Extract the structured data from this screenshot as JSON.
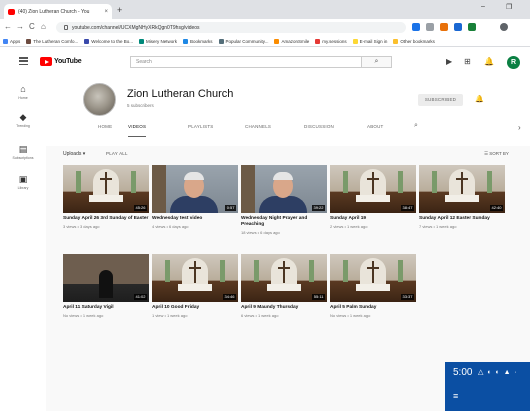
{
  "browser": {
    "tab_title": "(40) Zion Lutheran Church - You",
    "tab_close": "×",
    "new_tab": "+",
    "window_controls": [
      "–",
      "❐"
    ],
    "nav": [
      "←",
      "→",
      "C",
      "⌂"
    ],
    "url": "youtube.com/channel/UCXMgNHyXRkQgn0T9hsg/videos",
    "bookmarks": [
      "Apps",
      "The Lutheran Comfo...",
      "Welcome to the Bo...",
      "Misery Network",
      "Bookmarks",
      "Popular Community...",
      "AmazonSmile",
      "my.sessions",
      "E-mail Sign in",
      "Other bookmarks"
    ]
  },
  "masthead": {
    "logo_text": "YouTube",
    "search_placeholder": "Search",
    "search_icon": "⌕",
    "icons": [
      "▶",
      "⊞",
      "🔔"
    ],
    "avatar_letter": "R"
  },
  "guide": [
    {
      "icon": "⌂",
      "label": "Home"
    },
    {
      "icon": "◆",
      "label": "Trending"
    },
    {
      "icon": "▤",
      "label": "Subscriptions"
    },
    {
      "icon": "▣",
      "label": "Library"
    }
  ],
  "channel": {
    "name": "Zion Lutheran Church",
    "subscribers": "5 subscribers",
    "subscribe_label": "SUBSCRIBED",
    "bell": "🔔",
    "tabs": [
      "HOME",
      "VIDEOS",
      "PLAYLISTS",
      "CHANNELS",
      "DISCUSSION",
      "ABOUT"
    ],
    "active_tab": "VIDEOS",
    "tab_search": "⌕",
    "tab_arrow": "›"
  },
  "uploads": {
    "label": "Uploads ▾",
    "play_all": "PLAY ALL",
    "sort": "☰  SORT BY"
  },
  "videos": [
    {
      "title": "Sunday April 26 3rd Sunday of Easter",
      "meta": "3 views • 3 days ago",
      "duration": "45:26",
      "thumb": "church"
    },
    {
      "title": "Wednesday test video",
      "meta": "4 views • 6 days ago",
      "duration": "0:57",
      "thumb": "man"
    },
    {
      "title": "Wednesday Night Prayer and Preaching",
      "meta": "18 views • 6 days ago",
      "duration": "39:22",
      "thumb": "man"
    },
    {
      "title": "Sunday April 19",
      "meta": "2 views • 1 week ago",
      "duration": "38:47",
      "thumb": "church"
    },
    {
      "title": "Sunday April 12 Easter Sunday",
      "meta": "7 views • 1 week ago",
      "duration": "42:40",
      "thumb": "church"
    },
    {
      "title": "April 11 Saturday Vigil",
      "meta": "No views • 1 week ago",
      "duration": "41:02",
      "thumb": "dark"
    },
    {
      "title": "April 10 Good Friday",
      "meta": "1 view • 1 week ago",
      "duration": "34:46",
      "thumb": "church"
    },
    {
      "title": "April 9 Maundy Thursday",
      "meta": "6 views • 1 week ago",
      "duration": "55:11",
      "thumb": "church"
    },
    {
      "title": "April 5 Palm Sunday",
      "meta": "No views • 1 week ago",
      "duration": "33:37",
      "thumb": "church"
    }
  ],
  "tray": {
    "time": "5:00",
    "icons": "△ ◐ ◐ ▲ ·",
    "menu": "≡"
  },
  "colors": {
    "youtube_red": "#ff0000",
    "tray_blue": "#0b4fa3",
    "avatar_green": "#0b8043"
  }
}
